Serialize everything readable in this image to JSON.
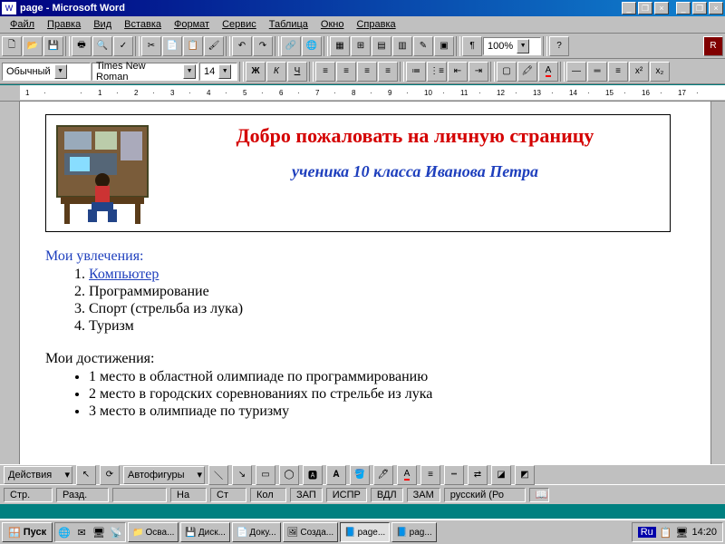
{
  "titlebar": {
    "title": "page - Microsoft Word"
  },
  "menu": [
    "Файл",
    "Правка",
    "Вид",
    "Вставка",
    "Формат",
    "Сервис",
    "Таблица",
    "Окно",
    "Справка"
  ],
  "format": {
    "style": "Обычный",
    "font": "Times New Roman",
    "size": "14",
    "zoom": "100%"
  },
  "document": {
    "heading": "Добро пожаловать на личную страницу",
    "subheading": "ученика 10 класса Иванова Петра",
    "hobbies_label": "Мои увлечения:",
    "hobbies": [
      "Компьютер",
      "Программирование",
      "Спорт (стрельба из лука)",
      "Туризм"
    ],
    "achievements_label": "Мои достижения:",
    "achievements": [
      "1 место в областной олимпиаде по программированию",
      "2 место в городских соревнованиях по стрельбе из лука",
      "3 место в олимпиаде по туризму"
    ]
  },
  "drawbar": {
    "actions": "Действия",
    "autoshapes": "Автофигуры"
  },
  "status": {
    "page": "Стр.",
    "razd": "Разд.",
    "na": "На",
    "st": "Ст",
    "kol": "Кол",
    "zap": "ЗАП",
    "ispr": "ИСПР",
    "vdl": "ВДЛ",
    "zam": "ЗАМ",
    "lang": "русский (Ро"
  },
  "taskbar": {
    "start": "Пуск",
    "items": [
      "Осва...",
      "Диск...",
      "Доку...",
      "Созда...",
      "page...",
      "pag..."
    ],
    "lang": "Ru",
    "time": "14:20"
  },
  "ruler": [
    "1",
    "",
    "1",
    "2",
    "3",
    "4",
    "5",
    "6",
    "7",
    "8",
    "9",
    "10",
    "11",
    "12",
    "13",
    "14",
    "15",
    "16",
    "17"
  ]
}
